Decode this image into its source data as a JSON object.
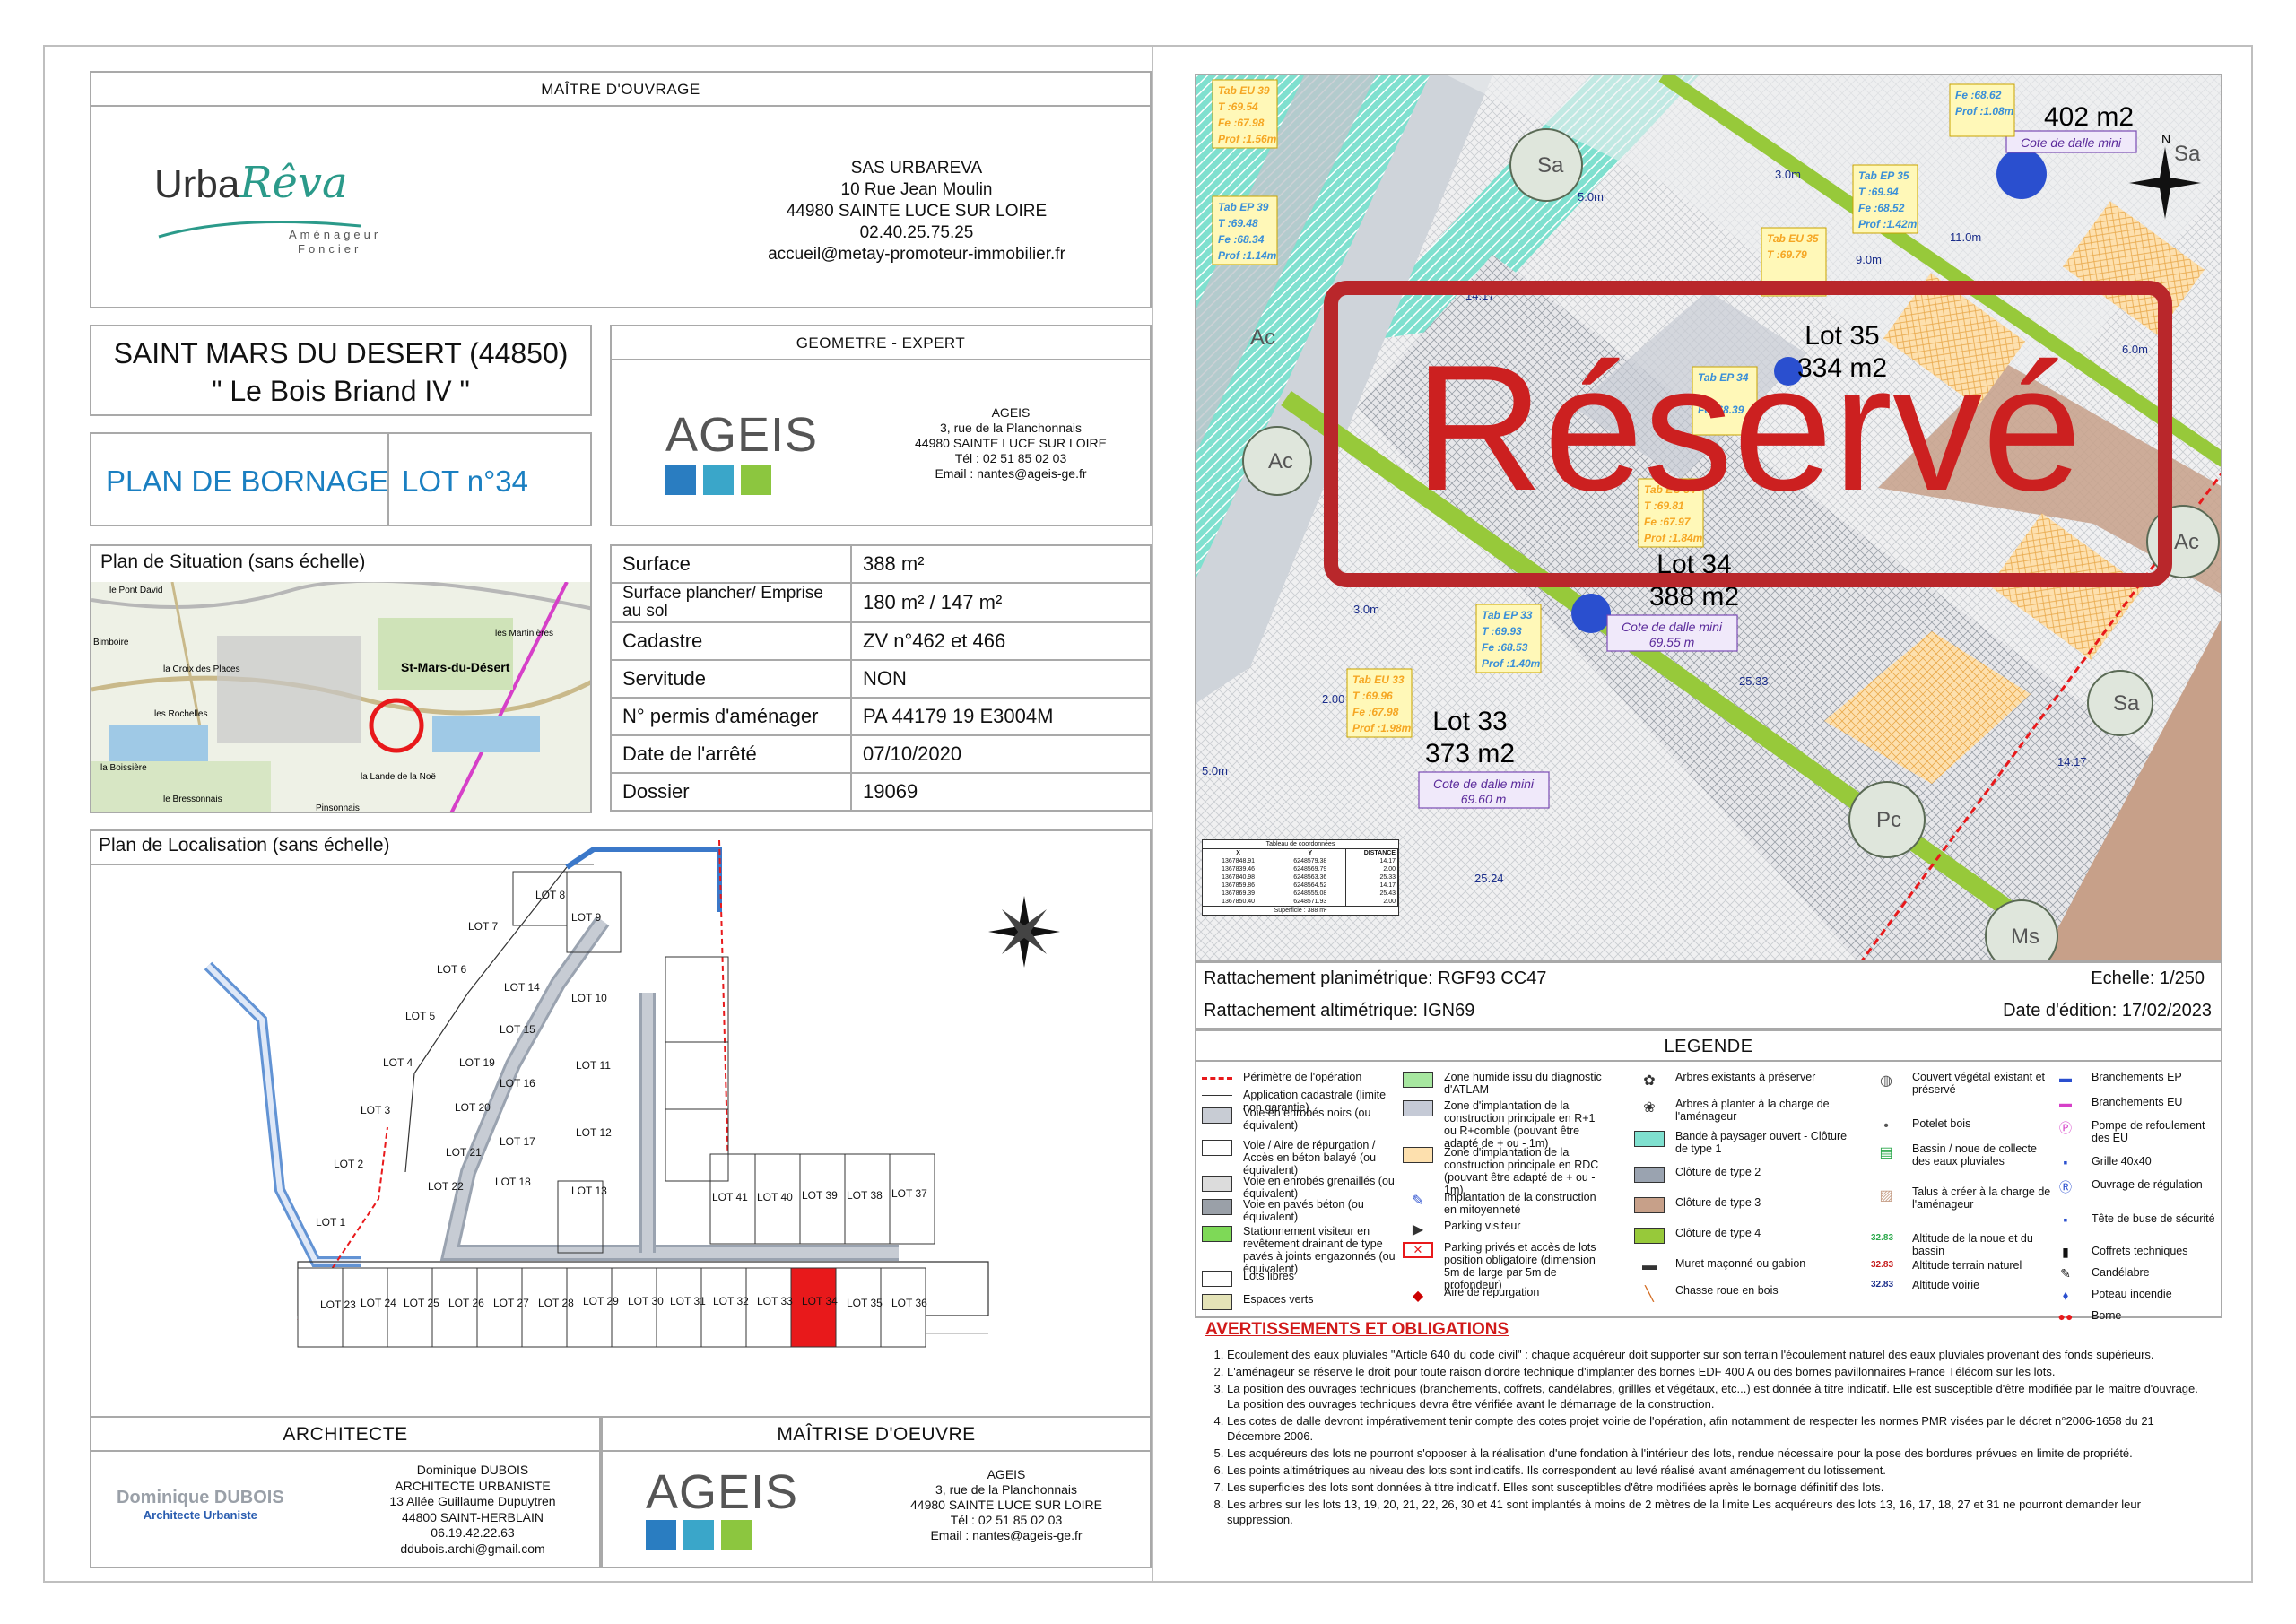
{
  "maitre_ouvrage": {
    "header": "MAÎTRE D'OUVRAGE",
    "logo_main": "Urba",
    "logo_script": "Rêva",
    "logo_sub1": "Aménageur",
    "logo_sub2": "Foncier",
    "lines": [
      "SAS URBAREVA",
      "10 Rue Jean Moulin",
      "44980 SAINTE LUCE SUR LOIRE",
      "02.40.25.75.25",
      "accueil@metay-promoteur-immobilier.fr"
    ]
  },
  "project": {
    "city": "SAINT MARS DU DESERT (44850)",
    "name": "\" Le Bois Briand IV \""
  },
  "plan_type": "PLAN DE BORNAGE",
  "lot": "LOT n°34",
  "geometre": {
    "header": "GEOMETRE - EXPERT",
    "logo": "AGEIS",
    "lines": [
      "AGEIS",
      "3, rue de la Planchonnais",
      "44980 SAINTE LUCE SUR LOIRE",
      "Tél : 02 51 85 02 03",
      "Email : nantes@ageis-ge.fr"
    ]
  },
  "situation": {
    "title": "Plan de Situation (sans échelle)",
    "labels": [
      "le Pont David",
      "Bimboire",
      "la Croix des Places",
      "St-Mars-du-Désert",
      "les Martinières",
      "les Rochelles",
      "la Boissière",
      "la Lande de la Noë",
      "le Bressonnais",
      "Pinsonnais"
    ]
  },
  "info_rows": [
    {
      "label": "Surface",
      "value": "388 m²"
    },
    {
      "label": "Surface plancher/ Emprise au sol",
      "value": "180 m² / 147 m²"
    },
    {
      "label": "Cadastre",
      "value": "ZV n°462 et 466"
    },
    {
      "label": "Servitude",
      "value": "NON"
    },
    {
      "label": "N° permis d'aménager",
      "value": "PA 44179 19 E3004M"
    },
    {
      "label": "Date de l'arrêté",
      "value": "07/10/2020"
    },
    {
      "label": "Dossier",
      "value": "19069"
    }
  ],
  "localisation": {
    "title": "Plan de Localisation (sans échelle)",
    "lots": [
      "LOT 1",
      "LOT 2",
      "LOT 3",
      "LOT 4",
      "LOT 5",
      "LOT 6",
      "LOT 7",
      "LOT 8",
      "LOT 9",
      "LOT 10",
      "LOT 11",
      "LOT 12",
      "LOT 13",
      "LOT 14",
      "LOT 15",
      "LOT 16",
      "LOT 17",
      "LOT 18",
      "LOT 19",
      "LOT 20",
      "LOT 21",
      "LOT 22",
      "LOT 23",
      "LOT 24",
      "LOT 25",
      "LOT 26",
      "LOT 27",
      "LOT 28",
      "LOT 29",
      "LOT 30",
      "LOT 31",
      "LOT 32",
      "LOT 33",
      "LOT 34",
      "LOT 35",
      "LOT 36",
      "LOT 37",
      "LOT 38",
      "LOT 39",
      "LOT 40",
      "LOT 41"
    ],
    "highlighted": "LOT 34",
    "highlight_color": "#e8191b"
  },
  "architecte": {
    "header": "ARCHITECTE",
    "logo_name": "Dominique DUBOIS",
    "logo_sub": "Architecte Urbaniste",
    "lines": [
      "Dominique DUBOIS",
      "ARCHITECTE URBANISTE",
      "13 Allée Guillaume Dupuytren",
      "44800 SAINT-HERBLAIN",
      "06.19.42.22.63",
      "ddubois.archi@gmail.com"
    ]
  },
  "maitrise": {
    "header": "MAÎTRISE D'OEUVRE",
    "logo": "AGEIS",
    "lines": [
      "AGEIS",
      "3, rue de la Planchonnais",
      "44980 SAINTE LUCE SUR LOIRE",
      "Tél : 02 51 85 02 03",
      "Email : nantes@ageis-ge.fr"
    ]
  },
  "plan": {
    "stamp": "Réservé",
    "stamp_color": "#cc2020",
    "lots": [
      {
        "name": "Lot 35",
        "area": "334 m2"
      },
      {
        "name": "Lot 34",
        "area": "388 m2"
      },
      {
        "name": "Lot 33",
        "area": "373 m2"
      },
      {
        "name": "",
        "area": "402 m2"
      }
    ],
    "cotes": [
      {
        "label": "Cote de dalle mini",
        "value": "69.55 m"
      },
      {
        "label": "Cote de dalle mini",
        "value": "69.60 m"
      },
      {
        "label": "Cote de dalle mini",
        "value": ""
      }
    ],
    "tabs": [
      {
        "title": "Tab EU 39",
        "lines": [
          "T :69.54",
          "Fe :67.98",
          "Prof :1.56m"
        ]
      },
      {
        "title": "Tab EP 39",
        "lines": [
          "T :69.48",
          "Fe :68.34",
          "Prof :1.14m"
        ]
      },
      {
        "title": "Tab EU 35",
        "lines": [
          "T :69.79",
          "",
          "Prof :1.68m"
        ]
      },
      {
        "title": "Tab EP 35",
        "lines": [
          "T :69.94",
          "Fe :68.52",
          "Prof :1.42m"
        ]
      },
      {
        "title": "Tab EP 34",
        "lines": [
          "",
          "Fe :68.39",
          ""
        ]
      },
      {
        "title": "Tab EU 34",
        "lines": [
          "T :69.81",
          "Fe :67.97",
          "Prof :1.84m"
        ]
      },
      {
        "title": "Tab EP 33",
        "lines": [
          "T :69.93",
          "Fe :68.53",
          "Prof :1.40m"
        ]
      },
      {
        "title": "Tab EU 33",
        "lines": [
          "T :69.96",
          "Fe :67.98",
          "Prof :1.98m"
        ]
      },
      {
        "title": "",
        "lines": [
          "Fe :68.62",
          "Prof :1.08m"
        ]
      }
    ],
    "dims": [
      "5.0m",
      "3.0m",
      "9.0m",
      "11.0m",
      "6.0m",
      "25.33",
      "25.24",
      "14.17",
      "14.17",
      "2.00",
      "5.0m",
      "3.0m"
    ],
    "trees": [
      "Sa",
      "Ac",
      "Sa",
      "Pc",
      "Ac",
      "Ms",
      "Sa",
      "Ac"
    ]
  },
  "coord_table": {
    "title": "Tableau de coordonnées",
    "headers": [
      "X",
      "Y",
      "DISTANCE"
    ],
    "rows": [
      [
        "1367848.91",
        "6248579.38",
        "14.17"
      ],
      [
        "1367839.46",
        "6248569.79",
        "2.00"
      ],
      [
        "1367840.98",
        "6248563.36",
        "25.33"
      ],
      [
        "1367859.86",
        "6248564.52",
        "14.17"
      ],
      [
        "1367869.39",
        "6248555.08",
        "25.43"
      ],
      [
        "1367850.40",
        "6248571.93",
        "2.00"
      ]
    ],
    "footer": "Superficie : 388 m²"
  },
  "rattachement": {
    "plani": "Rattachement planimétrique: RGF93 CC47",
    "alti": "Rattachement altimétrique: IGN69",
    "echelle": "Echelle: 1/250",
    "date": "Date d'édition: 17/02/2023"
  },
  "legende": {
    "title": "LEGENDE",
    "col1": [
      "Périmètre de l'opération",
      "Application cadastrale (limite non garantie)",
      "Voie en enrobés noirs (ou équivalent)",
      "Voie / Aire de répurgation / Accès en béton balayé (ou équivalent)",
      "Voie en enrobés grenaillés (ou équivalent)",
      "Voie en pavés béton (ou équivalent)",
      "Stationnement visiteur en revêtement drainant de type pavés à joints engazonnés (ou équivalent)",
      "Lots libres",
      "Espaces verts"
    ],
    "col2": [
      "Zone humide issu du diagnostic d'ATLAM",
      "Zone d'implantation de la construction principale en R+1 ou R+comble (pouvant être adapté de + ou - 1m)",
      "Zone d'implantation de la construction principale en RDC (pouvant être adapté de + ou - 1m)",
      "Implantation de la construction en mitoyenneté",
      "Parking visiteur",
      "Parking privés et accès de lots position obligatoire (dimension 5m de large par 5m de profondeur)",
      "Aire de répurgation"
    ],
    "col3": [
      "Arbres existants à préserver",
      "Arbres à planter à la charge de l'aménageur",
      "Bande à paysager ouvert - Clôture de type 1",
      "Clôture de type 2",
      "Clôture de type 3",
      "Clôture de type 4",
      "Muret maçonné ou gabion",
      "Chasse roue en bois"
    ],
    "col4": [
      "Couvert végétal existant et préservé",
      "Potelet bois",
      "Bassin / noue de collecte des eaux pluviales",
      "Talus à créer à la charge de l'aménageur",
      "Altitude de la noue et du bassin",
      "Altitude terrain naturel",
      "Altitude voirie"
    ],
    "col4_values": [
      "32.83",
      "32.83",
      "32.83"
    ],
    "col5": [
      "Branchements EP",
      "Branchements EU",
      "Pompe de refoulement des EU",
      "Grille 40x40",
      "Ouvrage de régulation",
      "Tête de buse de sécurité",
      "Coffrets techniques",
      "Candélabre",
      "Poteau incendie",
      "Borne"
    ]
  },
  "avertissements": {
    "title": "AVERTISSEMENTS ET OBLIGATIONS",
    "items": [
      "Ecoulement des eaux pluviales \"Article 640 du code civil\" : chaque acquéreur doit supporter sur son terrain l'écoulement naturel des eaux pluviales provenant des fonds supérieurs.",
      "L'aménageur se réserve le droit pour toute raison d'ordre technique d'implanter des bornes EDF 400 A ou des bornes pavillonnaires France Télécom sur les lots.",
      "La position des ouvrages techniques (branchements, coffrets, candélabres, grillles et végétaux, etc...) est donnée à titre indicatif. Elle est susceptible d'être modifiée par le maître d'ouvrage. La position des ouvrages techniques devra être vérifiée avant le démarrage de la construction.",
      "Les cotes de dalle devront impérativement tenir compte des cotes projet voirie de l'opération, afin notamment de respecter les normes PMR visées par le décret n°2006-1658 du 21 Décembre 2006.",
      "Les acquéreurs des lots ne pourront s'opposer à la réalisation d'une fondation à l'intérieur des lots, rendue nécessaire pour la pose des bordures prévues en limite de propriété.",
      "Les points altimétriques au niveau des lots sont indicatifs. Ils correspondent au levé réalisé avant aménagement du lotissement.",
      "Les superficies des lots sont données à titre indicatif. Elles sont susceptibles d'être modifiées après le bornage définitif des lots.",
      "Les arbres sur les lots 13, 19, 20, 21, 22, 26, 30 et 41 sont implantés à moins de 2 mètres de la limite Les acquéreurs des lots 13, 16, 17, 18, 27 et 31 ne pourront demander leur suppression."
    ]
  },
  "colors": {
    "border": "#a9a9a9",
    "blue_title": "#1a7fc1",
    "ageis_teal": "#3aa6c9",
    "ageis_green": "#8cc63f",
    "urba_green": "#2b9a8a"
  }
}
